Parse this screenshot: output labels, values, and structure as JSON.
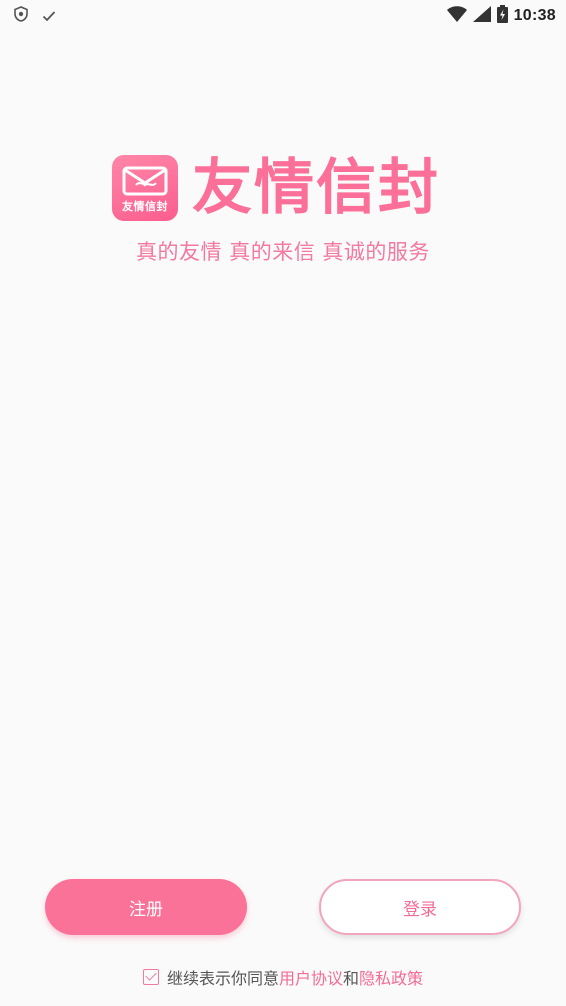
{
  "status_bar": {
    "time": "10:38",
    "icons": [
      "shield-icon",
      "check-icon",
      "wifi-icon",
      "signal-icon",
      "battery-charging-icon"
    ]
  },
  "brand": {
    "logo_text": "友情信封",
    "title": "友情信封",
    "slogan": "真的友情 真的来信 真诚的服务",
    "accent_color": "#fb6f98"
  },
  "actions": {
    "register_label": "注册",
    "login_label": "登录"
  },
  "agreement": {
    "prefix": "继续表示你同意",
    "user_agreement": "用户协议",
    "conjunction": "和",
    "privacy_policy": "隐私政策",
    "checked": true
  }
}
